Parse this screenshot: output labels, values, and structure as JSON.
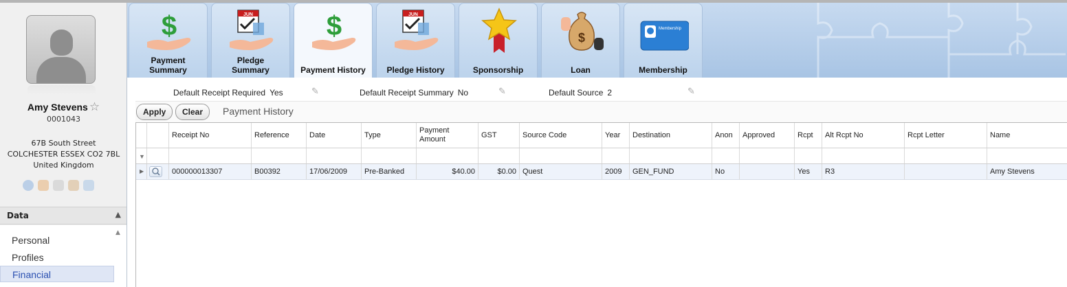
{
  "profile": {
    "name": "Amy Stevens",
    "id": "0001043",
    "address_line1": "67B South Street",
    "address_line2": "COLCHESTER ESSEX CO2 7BL",
    "address_line3": "United Kingdom",
    "favorite_icon": "star-outline-icon"
  },
  "sidebar": {
    "section_title": "Data",
    "items": [
      {
        "label": "Personal",
        "active": false
      },
      {
        "label": "Profiles",
        "active": false
      },
      {
        "label": "Financial",
        "active": true
      }
    ]
  },
  "tabs": [
    {
      "label1": "Payment",
      "label2": "Summary",
      "icon": "money-hand-icon",
      "active": false
    },
    {
      "label1": "Pledge",
      "label2": "Summary",
      "icon": "calendar-hand-icon",
      "active": false
    },
    {
      "label1": "Payment History",
      "label2": "",
      "icon": "money-hand-icon",
      "active": true
    },
    {
      "label1": "Pledge History",
      "label2": "",
      "icon": "calendar-hand-icon",
      "active": false
    },
    {
      "label1": "Sponsorship",
      "label2": "",
      "icon": "star-ribbon-icon",
      "active": false
    },
    {
      "label1": "Loan",
      "label2": "",
      "icon": "money-bag-icon",
      "active": false
    },
    {
      "label1": "Membership",
      "label2": "",
      "icon": "membership-card-icon",
      "active": false
    }
  ],
  "tab_icon_text": {
    "calendar_month": "JUN",
    "card_text": "Membership"
  },
  "defaults": {
    "receipt_required_label": "Default Receipt Required",
    "receipt_required_value": "Yes",
    "receipt_summary_label": "Default Receipt Summary",
    "receipt_summary_value": "No",
    "source_label": "Default Source",
    "source_value": "2"
  },
  "actions": {
    "apply_label": "Apply",
    "clear_label": "Clear",
    "section_title": "Payment History"
  },
  "grid": {
    "columns": [
      "Receipt No",
      "Reference",
      "Date",
      "Type",
      "Payment Amount",
      "GST",
      "Source Code",
      "Year",
      "Destination",
      "Anon",
      "Approved",
      "Rcpt",
      "Alt Rcpt No",
      "Rcpt Letter",
      "Name"
    ],
    "rows": [
      [
        "000000013307",
        "B00392",
        "17/06/2009",
        "Pre-Banked",
        "$40.00",
        "$0.00",
        "Quest",
        "2009",
        "GEN_FUND",
        "No",
        "",
        "Yes",
        "R3",
        "",
        "Amy Stevens"
      ]
    ]
  },
  "colors": {
    "accent": "#2a4fb0",
    "tabbar": "#b3cce9",
    "row_highlight": "#eef3fb"
  }
}
